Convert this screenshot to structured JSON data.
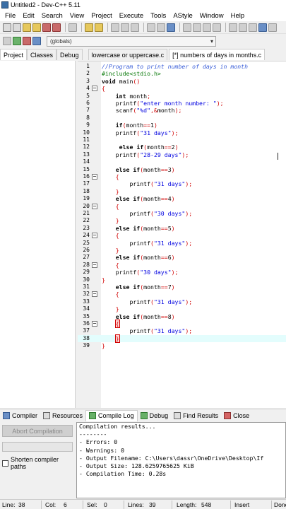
{
  "window": {
    "title": "Untitled2 - Dev-C++ 5.11"
  },
  "menu": [
    "File",
    "Edit",
    "Search",
    "View",
    "Project",
    "Execute",
    "Tools",
    "AStyle",
    "Window",
    "Help"
  ],
  "toolbar2": {
    "scope_value": "(globals)"
  },
  "panel_tabs": [
    "Project",
    "Classes",
    "Debug"
  ],
  "file_tabs": [
    {
      "label": "lowercase or uppercase.c",
      "active": false
    },
    {
      "label": "[*] numbers of days in months.c",
      "active": true
    }
  ],
  "editor": {
    "highlighted_line": 38,
    "lines": [
      {
        "n": "1",
        "fold": "",
        "code": "//Program to print number of days in month",
        "kind": "comment"
      },
      {
        "n": "2",
        "fold": "",
        "code": "#include<stdio.h>",
        "kind": "pre"
      },
      {
        "n": "3",
        "fold": "",
        "code": "void main()",
        "kind": "code"
      },
      {
        "n": "4",
        "fold": "-",
        "code": "{",
        "kind": "code"
      },
      {
        "n": "5",
        "fold": "",
        "code": "    int month;",
        "kind": "code"
      },
      {
        "n": "6",
        "fold": "",
        "code": "    printf(\"enter month number: \");",
        "kind": "code"
      },
      {
        "n": "7",
        "fold": "",
        "code": "    scanf(\"%d\",&month);",
        "kind": "code"
      },
      {
        "n": "8",
        "fold": "",
        "code": "",
        "kind": "code"
      },
      {
        "n": "9",
        "fold": "",
        "code": "    if(month==1)",
        "kind": "code"
      },
      {
        "n": "10",
        "fold": "",
        "code": "    printf(\"31 days\");",
        "kind": "code"
      },
      {
        "n": "11",
        "fold": "",
        "code": "",
        "kind": "code"
      },
      {
        "n": "12",
        "fold": "",
        "code": "     else if(month==2)",
        "kind": "code"
      },
      {
        "n": "13",
        "fold": "",
        "code": "    printf(\"28-29 days\");",
        "kind": "code"
      },
      {
        "n": "14",
        "fold": "",
        "code": "",
        "kind": "code"
      },
      {
        "n": "15",
        "fold": "",
        "code": "    else if(month==3)",
        "kind": "code"
      },
      {
        "n": "16",
        "fold": "-",
        "code": "    {",
        "kind": "code"
      },
      {
        "n": "17",
        "fold": "",
        "code": "        printf(\"31 days\");",
        "kind": "code"
      },
      {
        "n": "18",
        "fold": "",
        "code": "    }",
        "kind": "code"
      },
      {
        "n": "19",
        "fold": "",
        "code": "    else if(month==4)",
        "kind": "code"
      },
      {
        "n": "20",
        "fold": "-",
        "code": "    {",
        "kind": "code"
      },
      {
        "n": "21",
        "fold": "",
        "code": "        printf(\"30 days\");",
        "kind": "code"
      },
      {
        "n": "22",
        "fold": "",
        "code": "    }",
        "kind": "code"
      },
      {
        "n": "23",
        "fold": "",
        "code": "    else if(month==5)",
        "kind": "code"
      },
      {
        "n": "24",
        "fold": "-",
        "code": "    {",
        "kind": "code"
      },
      {
        "n": "25",
        "fold": "",
        "code": "        printf(\"31 days\");",
        "kind": "code"
      },
      {
        "n": "26",
        "fold": "",
        "code": "    }",
        "kind": "code"
      },
      {
        "n": "27",
        "fold": "",
        "code": "    else if(month==6)",
        "kind": "code"
      },
      {
        "n": "28",
        "fold": "-",
        "code": "    {",
        "kind": "code"
      },
      {
        "n": "29",
        "fold": "",
        "code": "    printf(\"30 days\");",
        "kind": "code"
      },
      {
        "n": "30",
        "fold": "",
        "code": "}",
        "kind": "code"
      },
      {
        "n": "31",
        "fold": "",
        "code": "    else if(month==7)",
        "kind": "code"
      },
      {
        "n": "32",
        "fold": "-",
        "code": "    {",
        "kind": "code"
      },
      {
        "n": "33",
        "fold": "",
        "code": "        printf(\"31 days\");",
        "kind": "code"
      },
      {
        "n": "34",
        "fold": "",
        "code": "    }",
        "kind": "code"
      },
      {
        "n": "35",
        "fold": "",
        "code": "    else if(month==8)",
        "kind": "code"
      },
      {
        "n": "36",
        "fold": "-",
        "code": "    {",
        "kind": "code"
      },
      {
        "n": "37",
        "fold": "",
        "code": "        printf(\"31 days\");",
        "kind": "code"
      },
      {
        "n": "38",
        "fold": "",
        "code": "    }",
        "kind": "code"
      },
      {
        "n": "39",
        "fold": "",
        "code": "}",
        "kind": "code"
      }
    ]
  },
  "bottom_tabs": [
    "Compiler",
    "Resources",
    "Compile Log",
    "Debug",
    "Find Results",
    "Close"
  ],
  "log_panel": {
    "abort_label": "Abort Compilation",
    "shorten_label": "Shorten compiler paths",
    "lines": [
      "Compilation results...",
      "--------",
      "- Errors: 0",
      "- Warnings: 0",
      "- Output Filename: C:\\Users\\dassr\\OneDrive\\Desktop\\If",
      "- Output Size: 128.6259765625 KiB",
      "- Compilation Time: 0.28s"
    ]
  },
  "status": {
    "line_label": "Line:",
    "line_value": "38",
    "col_label": "Col:",
    "col_value": "6",
    "sel_label": "Sel:",
    "sel_value": "0",
    "lines_label": "Lines:",
    "lines_value": "39",
    "length_label": "Length:",
    "length_value": "548",
    "mode": "Insert",
    "done": "Done"
  },
  "colors": {
    "comment": "#3b5fd9",
    "preprocessor": "#0a7a0a",
    "string": "#0000e0",
    "symbol": "#d00000",
    "highlight_line": "#e3fdfd"
  }
}
